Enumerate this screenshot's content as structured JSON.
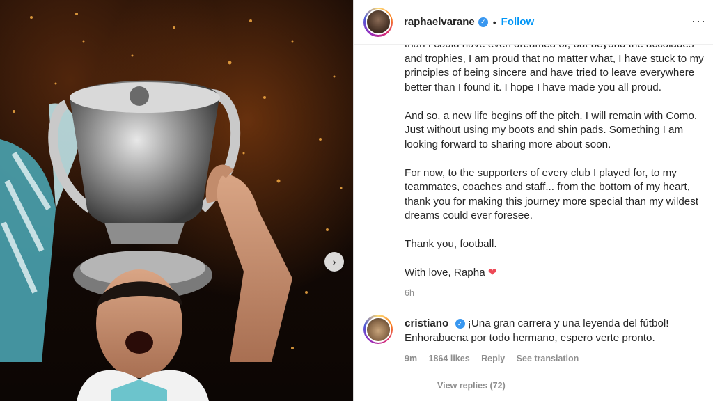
{
  "post": {
    "username": "raphaelvarane",
    "follow_label": "Follow",
    "separator": "•",
    "caption": [
      "than I could have even dreamed of, but beyond the accolades and trophies, I am proud that no matter what, I have stuck to my principles of being sincere and have tried to leave everywhere better than I found it. I hope I have made you all proud.",
      "And so, a new life begins off the pitch. I will remain with Como. Just without using my boots and shin pads. Something I am looking forward to sharing more about soon.",
      "For now, to the supporters of every club I played for, to my teammates, coaches and staff... from the bottom of my heart, thank you for making this journey more special than my wildest dreams could ever foresee.",
      "Thank you, football."
    ],
    "signoff": "With love, Rapha",
    "signoff_emoji": "❤",
    "time": "6h"
  },
  "comment": {
    "username": "cristiano",
    "text": "¡Una gran carrera y una leyenda del fútbol! Enhorabuena por todo hermano, espero verte pronto.",
    "age": "9m",
    "likes": "1864 likes",
    "reply_label": "Reply",
    "translation_label": "See translation",
    "view_replies": "View replies (72)"
  },
  "colors": {
    "link_blue": "#0095f6",
    "verified_blue": "#3897f0",
    "heart_red": "#ed4956",
    "muted": "#8e8e8e"
  },
  "icons": {
    "verified": "verified-badge-icon",
    "next": "chevron-right-icon",
    "more": "more-options-icon"
  }
}
